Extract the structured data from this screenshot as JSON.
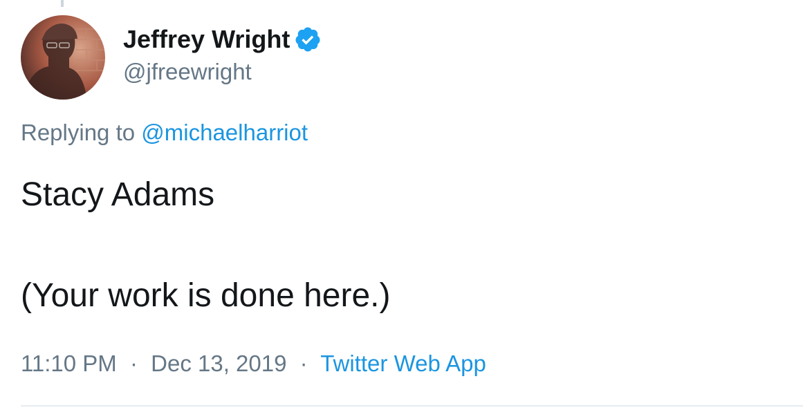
{
  "tweet": {
    "author": {
      "display_name": "Jeffrey Wright",
      "handle": "@jfreewright",
      "verified": true,
      "verified_icon": "verified-badge-icon"
    },
    "replying_to": {
      "prefix": "Replying to",
      "mention": "@michaelharriot"
    },
    "text_lines": [
      "Stacy Adams",
      "(Your work is done here.)"
    ],
    "meta": {
      "time": "11:10 PM",
      "date": "Dec 13, 2019",
      "separator": "·",
      "source": "Twitter Web App"
    }
  },
  "colors": {
    "text": "#14171a",
    "secondary": "#657786",
    "link": "#1b95e0",
    "verified": "#1da1f2",
    "divider": "#e6ecf0"
  }
}
